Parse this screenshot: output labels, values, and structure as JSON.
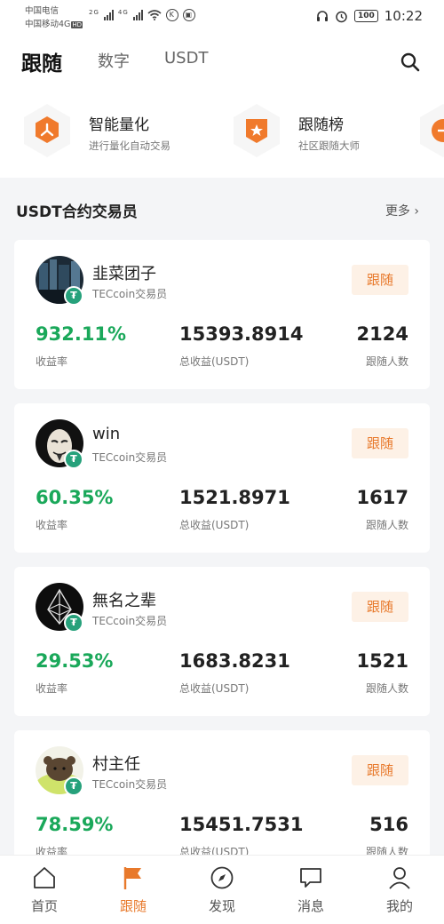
{
  "status_bar": {
    "carrier_1": "中国电信",
    "carrier_2": "中国移动4G",
    "hd_badge": "HD",
    "net_1": "2G",
    "net_2": "4G",
    "battery": "100",
    "time": "10:22"
  },
  "header": {
    "tabs": [
      {
        "label": "跟随"
      },
      {
        "label": "数字"
      },
      {
        "label": "USDT"
      }
    ],
    "search_icon": "search-icon"
  },
  "features": [
    {
      "title": "智能量化",
      "subtitle": "进行量化自动交易",
      "icon": "quant-icon"
    },
    {
      "title": "跟随榜",
      "subtitle": "社区跟随大师",
      "icon": "star-badge-icon"
    }
  ],
  "section": {
    "title": "USDT合约交易员",
    "more": "更多 ›"
  },
  "stat_labels": {
    "rate": "收益率",
    "total": "总收益(USDT)",
    "followers": "跟随人数"
  },
  "follow_label": "跟随",
  "traders": [
    {
      "name": "韭菜团子",
      "role": "TECcoin交易员",
      "rate": "932.11%",
      "total": "15393.8914",
      "followers": "2124"
    },
    {
      "name": "win",
      "role": "TECcoin交易员",
      "rate": "60.35%",
      "total": "1521.8971",
      "followers": "1617"
    },
    {
      "name": "無名之辈",
      "role": "TECcoin交易员",
      "rate": "29.53%",
      "total": "1683.8231",
      "followers": "1521"
    },
    {
      "name": "村主任",
      "role": "TECcoin交易员",
      "rate": "78.59%",
      "total": "15451.7531",
      "followers": "516"
    }
  ],
  "bottom_nav": [
    {
      "label": "首页",
      "icon": "home-icon"
    },
    {
      "label": "跟随",
      "icon": "flag-icon",
      "active": true
    },
    {
      "label": "发现",
      "icon": "compass-icon"
    },
    {
      "label": "消息",
      "icon": "message-icon"
    },
    {
      "label": "我的",
      "icon": "user-icon"
    }
  ],
  "colors": {
    "accent": "#e8792b",
    "positive": "#1aa85a",
    "tether": "#26a17b"
  }
}
